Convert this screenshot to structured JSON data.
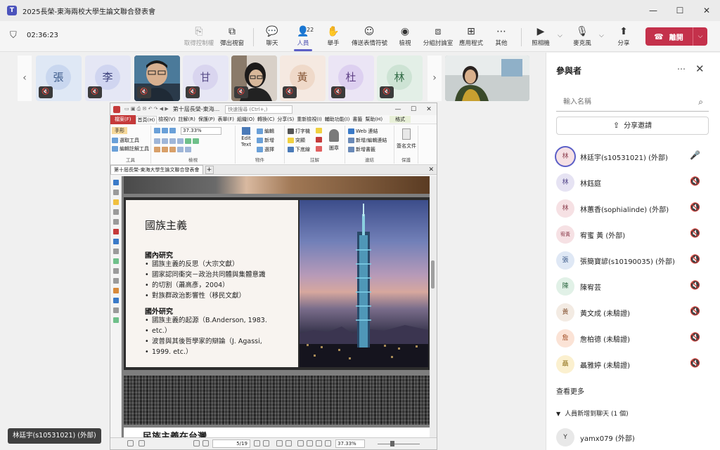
{
  "window": {
    "title": "2025長榮-東海兩校大學生論文聯合發表會",
    "minimize": "—",
    "maximize": "☐",
    "close": "✕"
  },
  "meeting": {
    "timer": "02:36:23",
    "toolbar": [
      {
        "label": "取得控制權",
        "icon": "⎘"
      },
      {
        "label": "彈出視窗",
        "icon": "⧉"
      },
      {
        "label": "聊天",
        "icon": "💬"
      },
      {
        "label": "人員",
        "icon": "👤",
        "count": "22"
      },
      {
        "label": "舉手",
        "icon": "✋"
      },
      {
        "label": "傳送表情符號",
        "icon": "☺"
      },
      {
        "label": "檢視",
        "icon": "◉"
      },
      {
        "label": "分組討論室",
        "icon": "⧈"
      },
      {
        "label": "應用程式",
        "icon": "⊞"
      },
      {
        "label": "其他",
        "icon": "⋯"
      },
      {
        "label": "照相機",
        "icon": "▶"
      },
      {
        "label": "麥克風",
        "icon": "🎙"
      },
      {
        "label": "分享",
        "icon": "⬆"
      }
    ],
    "leave": {
      "label": "離開",
      "icon": "☎"
    }
  },
  "gallery": [
    {
      "initial": "張",
      "bg": "#dfe8f5",
      "fg": "#3b5a8a",
      "avatar_bg": "#c9d7ef"
    },
    {
      "initial": "李",
      "bg": "#e5e7f5",
      "fg": "#3a3f7a",
      "avatar_bg": "#d0d5f0"
    },
    {
      "photo": true
    },
    {
      "initial": "甘",
      "bg": "#e7e7f5",
      "fg": "#5a4e8a",
      "avatar_bg": "#d9d5ef"
    },
    {
      "photo": true
    },
    {
      "initial": "黃",
      "bg": "#f5e9e1",
      "fg": "#8a5a3a",
      "avatar_bg": "#efd9c9"
    },
    {
      "initial": "杜",
      "bg": "#ebe5f5",
      "fg": "#5e3f85",
      "avatar_bg": "#ddd0f0"
    },
    {
      "initial": "林",
      "bg": "#e3efe7",
      "fg": "#2f6a44",
      "avatar_bg": "#cde3d4"
    }
  ],
  "speaker_name": "林廷宇(s10531021) (外部)",
  "pdf": {
    "title": "第十屆長榮-東海...",
    "search_placeholder": "快速搜尋 (Ctrl+,)",
    "menu": [
      "檔案(F)",
      "首頁(H)",
      "檢視(V)",
      "註解(R)",
      "保護(P)",
      "表單(F)",
      "組織(O)",
      "轉換(C)",
      "分享(S)",
      "重新檢視(I)",
      "輔助功能(I)",
      "書籤",
      "幫助(H)",
      "格式"
    ],
    "ribbon": {
      "hand": "手形",
      "select_tool": "選取工具",
      "edit_tool": "編輯註解工具",
      "tools_label": "工具",
      "zoom": "37.33%",
      "view_label": "檢視",
      "edit_text": "Edit Text",
      "edit": "編輯",
      "add": "新增",
      "select": "選擇",
      "object_label": "物件",
      "typewriter": "打字機",
      "highlight": "突顯",
      "underline": "下底線",
      "annot_label": "註解",
      "image": "圖章",
      "web_link": "Web 連結",
      "add_edit_link": "新增/編輯連結",
      "add_bookmark": "新增書籤",
      "link_label": "連結",
      "sign": "簽名文件",
      "protect_label": "保護"
    },
    "doc_tab": "第十屆長榮-東海大學生論文聯合發表會",
    "slide": {
      "title": "國族主義",
      "sec1": "國內研究",
      "items1": [
        "國族主義的反思（大宗文獻）",
        "國家認同衝突－政治共同體與集體意識",
        "的切割（蕭高彥，2004）",
        "對族群政治影響性（移民文獻）"
      ],
      "sec2": "國外研究",
      "items2": [
        "國族主義的起源（B.Anderson, 1983.",
        "etc.）",
        "波普與其後哲學家的辯論（J. Agassi,",
        "1999. etc.）"
      ],
      "next_title": "民族主義在台灣"
    },
    "status": {
      "page": "5/19",
      "zoom": "37.33%"
    }
  },
  "panel": {
    "title": "參與者",
    "more": "⋯",
    "close": "✕",
    "search_placeholder": "輸入名稱",
    "share": "分享邀請",
    "participants": [
      {
        "initial": "林",
        "name": "林廷宇(s10531021) (外部)",
        "bg": "#f6e1e4",
        "fg": "#8a3a4a",
        "speaking": true,
        "mic": "🎤"
      },
      {
        "initial": "林",
        "name": "林鈺庭",
        "bg": "#e6e3f3",
        "fg": "#4c3f85",
        "mic": "🔇"
      },
      {
        "initial": "林",
        "name": "林蕙香(sophialinde) (外部)",
        "bg": "#f6e1e4",
        "fg": "#8a3a4a",
        "mic": "🔇"
      },
      {
        "initial": "宥黃",
        "name": "宥蜜 黃 (外部)",
        "bg": "#f6e1e4",
        "fg": "#8a3a4a",
        "mic": "🔇"
      },
      {
        "initial": "張",
        "name": "張簡寶諺(s10190035) (外部)",
        "bg": "#dfe8f5",
        "fg": "#3b5a8a",
        "mic": "🔇"
      },
      {
        "initial": "陳",
        "name": "陳宥芸",
        "bg": "#e1f1e7",
        "fg": "#2f6a44",
        "mic": "🔇"
      },
      {
        "initial": "黃",
        "name": "黃文成 (未驗證)",
        "bg": "#f3ebe3",
        "fg": "#8a5a3a",
        "mic": "🔇"
      },
      {
        "initial": "詹",
        "name": "詹柏德 (未驗證)",
        "bg": "#fbe3d6",
        "fg": "#a04a20",
        "mic": "🔇"
      },
      {
        "initial": "聶",
        "name": "聶雅婷 (未驗證)",
        "bg": "#fbf0cf",
        "fg": "#8a6a10",
        "mic": "🔇"
      }
    ],
    "see_more": "查看更多",
    "joined": {
      "chev": "▼",
      "label": "人員新增到聊天 (1 個)"
    },
    "chat_participant": {
      "initial": "Y",
      "name": "yamx079 (外部)",
      "bg": "#e8e8e8",
      "fg": "#333"
    }
  }
}
